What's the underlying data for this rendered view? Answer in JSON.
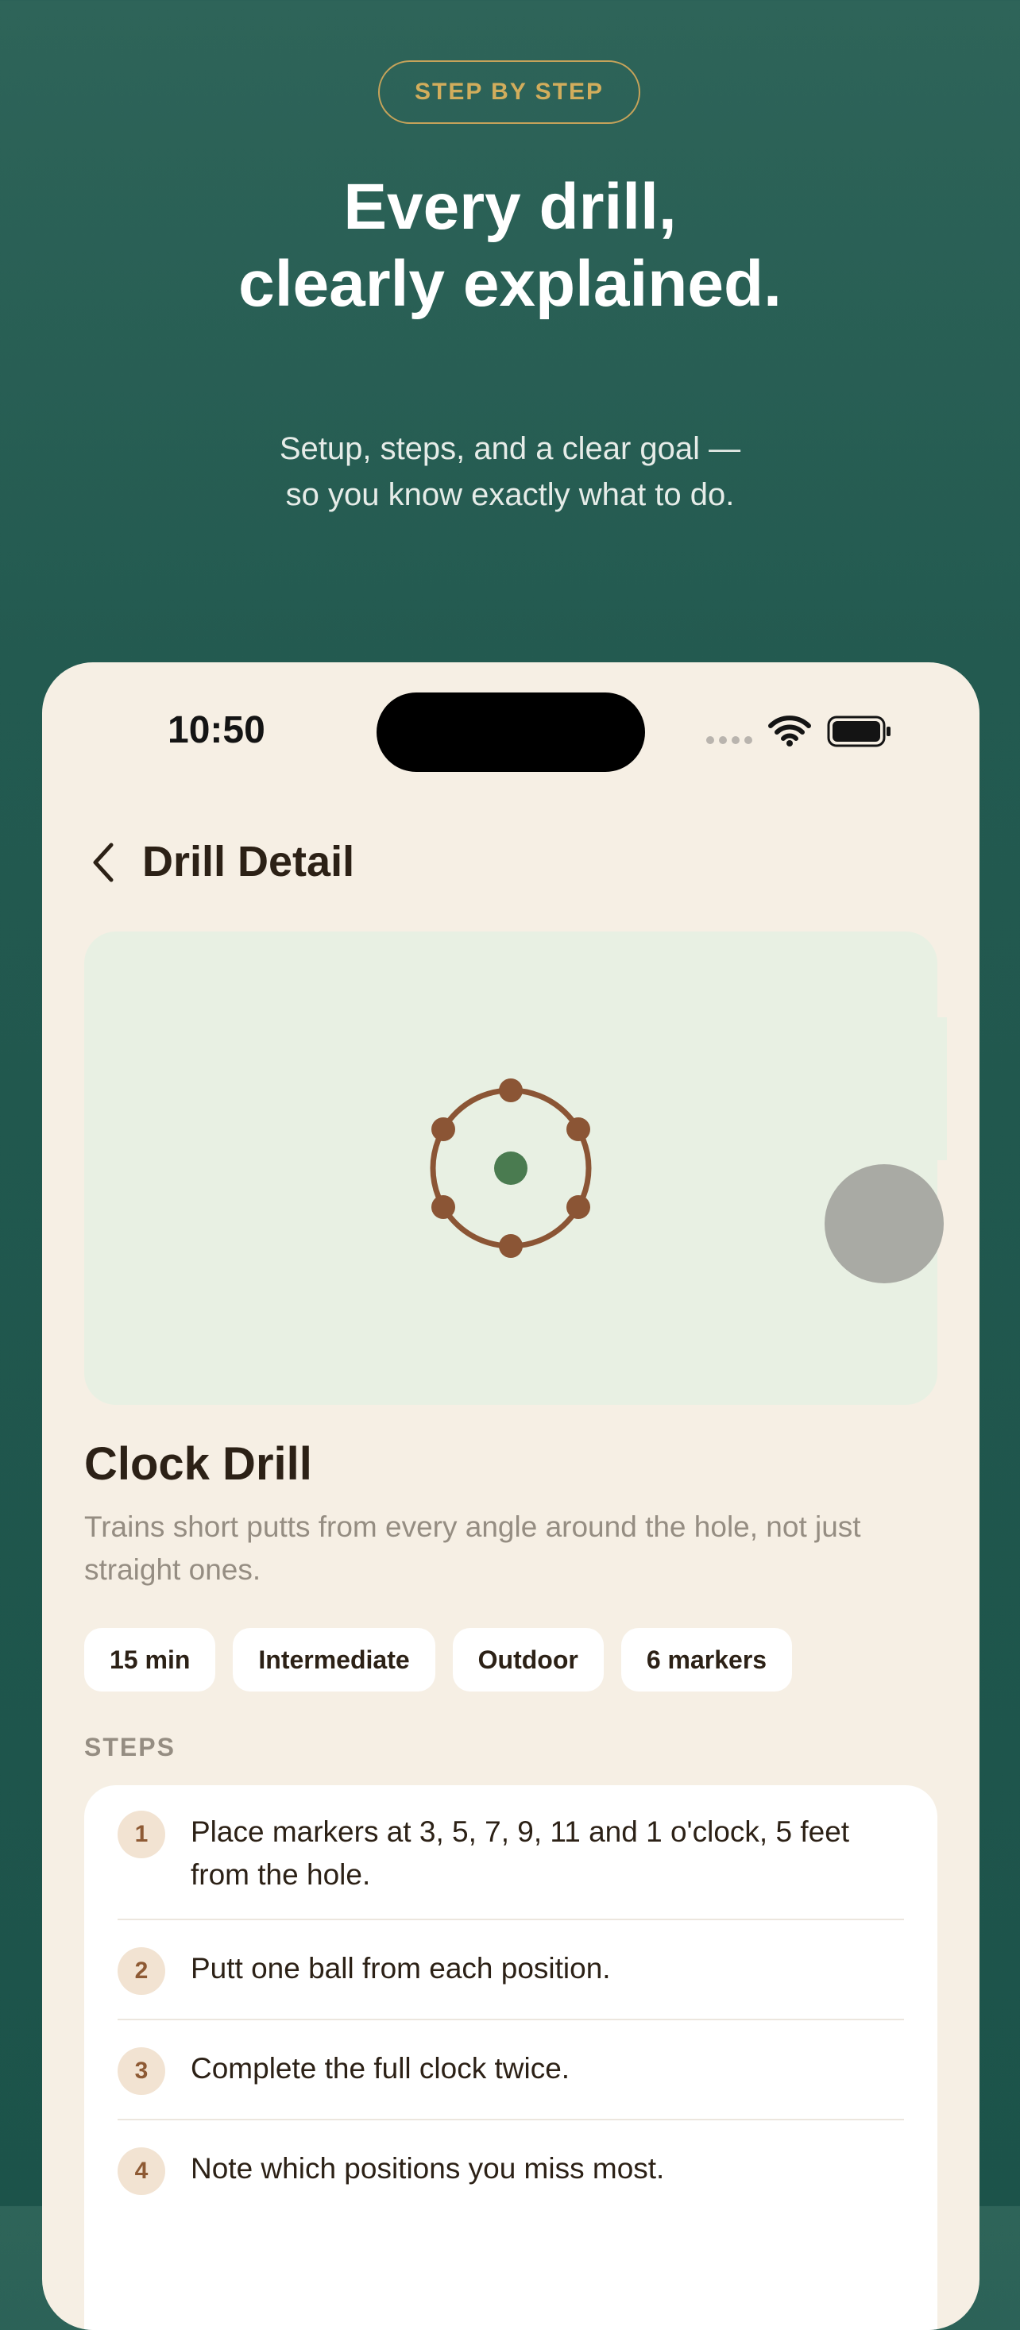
{
  "promo": {
    "badge": "STEP BY STEP",
    "headline_line1": "Every drill,",
    "headline_line2": "clearly explained.",
    "subhead_line1": "Setup, steps, and a clear goal —",
    "subhead_line2": "so you know exactly what to do."
  },
  "status_bar": {
    "time": "10:50",
    "icons": [
      "cellular-signal-icon",
      "wifi-icon",
      "battery-icon"
    ]
  },
  "nav": {
    "back_icon": "chevron-left-icon",
    "title": "Drill Detail"
  },
  "drill": {
    "name": "Clock Drill",
    "description": "Trains short putts from every angle around the hole, not just straight ones.",
    "tags": [
      "15 min",
      "Intermediate",
      "Outdoor",
      "6 markers"
    ],
    "diagram": {
      "markers_count": 6,
      "ring_color": "#8b5535",
      "hole_color": "#4a7b50",
      "background": "#e8f0e3"
    }
  },
  "steps": {
    "label": "STEPS",
    "items": [
      {
        "number": "1",
        "text": "Place markers at 3, 5, 7, 9, 11 and 1 o'clock, 5 feet from the hole."
      },
      {
        "number": "2",
        "text": "Putt one ball from each position."
      },
      {
        "number": "3",
        "text": "Complete the full clock twice."
      },
      {
        "number": "4",
        "text": "Note which positions you miss most."
      }
    ]
  },
  "colors": {
    "background_top": "#2e6459",
    "background_bottom": "#1c534a",
    "badge_gold": "#d2ad5c",
    "card_cream": "#f6efe4",
    "accent_brown": "#8b5535"
  }
}
